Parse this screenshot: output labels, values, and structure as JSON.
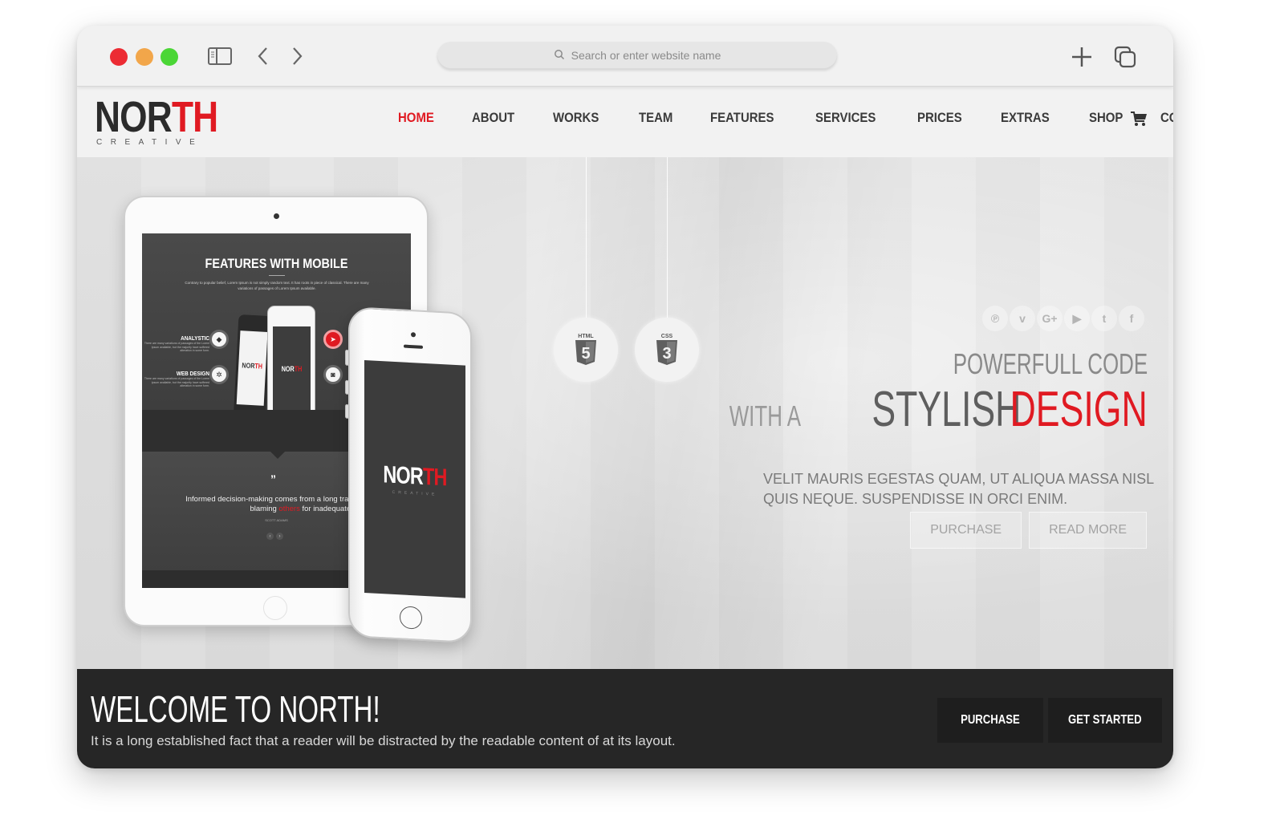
{
  "browser": {
    "address_placeholder": "Search or enter website name",
    "traffic_lights": {
      "close": "#ec2b33",
      "minimize": "#f2a64a",
      "maximize": "#4bd636"
    },
    "icons": [
      "sidebar-icon",
      "back-arrow-icon",
      "forward-arrow-icon",
      "search-icon",
      "new-tab-icon",
      "tabs-overview-icon"
    ]
  },
  "site": {
    "logo": {
      "dark_part": "NOR",
      "red_part": "TH",
      "tagline": "CREATIVE"
    },
    "colors": {
      "accent": "#e01a22",
      "dark": "#262626",
      "text": "#3a3a3a"
    },
    "nav": [
      {
        "label": "HOME",
        "active": true
      },
      {
        "label": "ABOUT",
        "active": false
      },
      {
        "label": "WORKS",
        "active": false
      },
      {
        "label": "TEAM",
        "active": false
      },
      {
        "label": "FEATURES",
        "active": false
      },
      {
        "label": "SERVICES",
        "active": false
      },
      {
        "label": "PRICES",
        "active": false
      },
      {
        "label": "EXTRAS",
        "active": false
      },
      {
        "label": "SHOP",
        "active": false
      },
      {
        "label": "CONTACT",
        "active": false
      }
    ],
    "cart_icon": "shopping-cart-icon"
  },
  "hero": {
    "badges": [
      {
        "label": "HTML",
        "number": "5"
      },
      {
        "label": "CSS",
        "number": "3"
      }
    ],
    "social": [
      {
        "name": "pinterest",
        "glyph": "℗"
      },
      {
        "name": "vimeo",
        "glyph": "v"
      },
      {
        "name": "google-plus",
        "glyph": "G+"
      },
      {
        "name": "youtube",
        "glyph": "▶"
      },
      {
        "name": "twitter",
        "glyph": "t"
      },
      {
        "name": "facebook",
        "glyph": "f"
      }
    ],
    "line1": "POWERFULL CODE",
    "line2_prefix": "WITH A",
    "line2_main": "STYLISH",
    "line2_accent": "DESIGN",
    "subtitle_1": "VELIT MAURIS EGESTAS QUAM, UT ALIQUA MASSA NISL",
    "subtitle_2": "QUIS NEQUE. SUSPENDISSE IN ORCI ENIM.",
    "buttons": {
      "purchase": "PURCHASE",
      "read_more": "READ MORE"
    }
  },
  "tablet_mock": {
    "title": "FEATURES WITH MOBILE",
    "intro": "Contrary to popular belief, Lorem Ipsum is not simply random text. It has roots in piece of classical. There are many variations of passages of Lorem Ipsum available.",
    "features": [
      {
        "title": "ANALYSTIC",
        "text": "There are many variations of passages of the Lorem Ipsum available, but the majority have suffered alteration in some form."
      },
      {
        "title": "WEB DESIGN",
        "text": "There are many variations of passages of the Lorem Ipsum available, but the majority have suffered alteration in some form."
      }
    ],
    "quote_before": "Informed decision-making comes from a long tradition of gu",
    "quote_line2_before": "blaming ",
    "quote_highlight": "others",
    "quote_line2_after": " for inadequate results.",
    "quote_mark": "”",
    "author": "SCOTT ADAMS",
    "mini_logo_dark": "NOR",
    "mini_logo_red": "TH"
  },
  "phone_mock": {
    "logo_dark": "NOR",
    "logo_red": "TH",
    "tagline": "CREATIVE"
  },
  "welcome": {
    "title": "WELCOME TO NORTH!",
    "text": "It is a long established fact that a reader will be distracted by the readable content of at its layout.",
    "buttons": {
      "purchase": "PURCHASE",
      "get_started": "GET STARTED"
    }
  }
}
